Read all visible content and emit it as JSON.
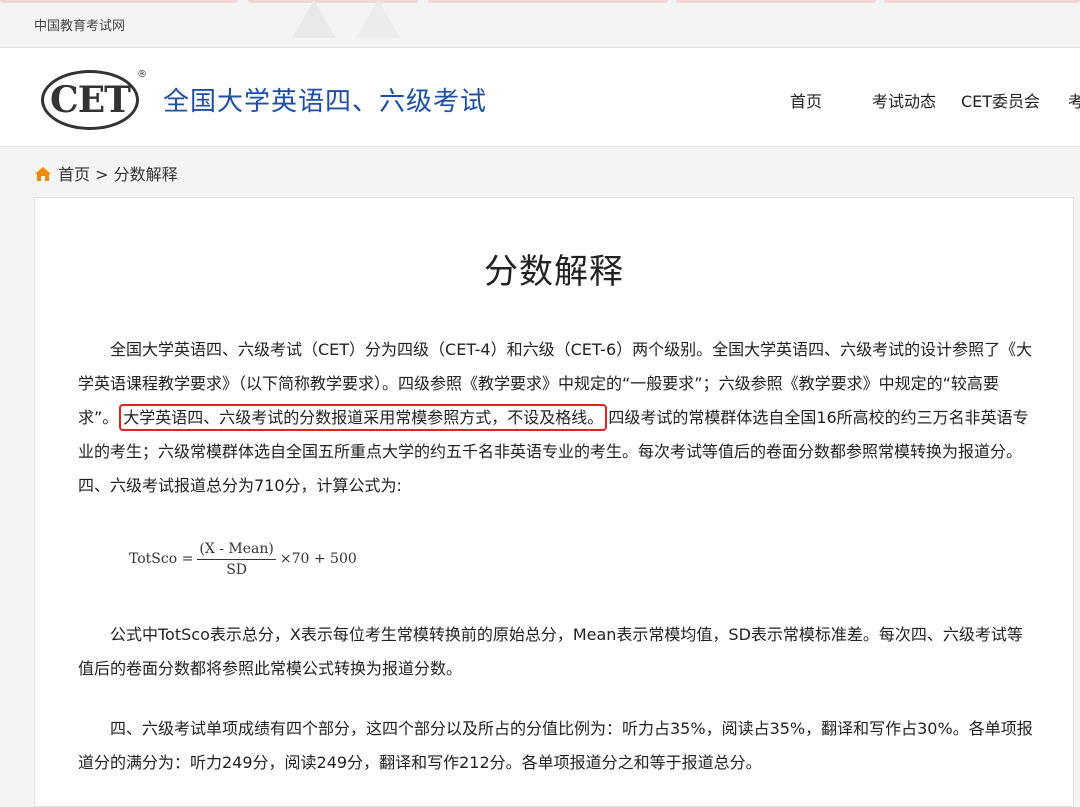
{
  "topbar": {
    "link": "中国教育考试网"
  },
  "header": {
    "logo_text": "CET",
    "logo_reg": "®",
    "site_title": "全国大学英语四、六级考试",
    "nav": [
      "首页",
      "考试动态",
      "CET委员会",
      "考"
    ]
  },
  "breadcrumb": {
    "home": "首页",
    "sep": " > ",
    "current": "分数解释"
  },
  "article": {
    "title": "分数解释",
    "p1_before": "全国大学英语四、六级考试（CET）分为四级（CET-4）和六级（CET-6）两个级别。全国大学英语四、六级考试的设计参照了《大学英语课程教学要求》（以下简称教学要求）。四级参照《教学要求》中规定的“一般要求”；六级参照《教学要求》中规定的“较高要求”。",
    "p1_highlight": "大学英语四、六级考试的分数报道采用常模参照方式，不设及格线。",
    "p1_after": "四级考试的常模群体选自全国16所高校的约三万名非英语专业的考生；六级常模群体选自全国五所重点大学的约五千名非英语专业的考生。每次考试等值后的卷面分数都参照常模转换为报道分。四、六级考试报道总分为710分，计算公式为:",
    "formula": {
      "lhs": "TotSco =",
      "numerator": "(X - Mean)",
      "denominator": "SD",
      "rhs": "×70 + 500"
    },
    "p2": "公式中TotSco表示总分，X表示每位考生常模转换前的原始总分，Mean表示常模均值，SD表示常模标准差。每次四、六级考试等值后的卷面分数都将参照此常模公式转换为报道分数。",
    "p3": "四、六级考试单项成绩有四个部分，这四个部分以及所占的分值比例为：听力占35%，阅读占35%，翻译和写作占30%。各单项报道分的满分为：听力249分，阅读249分，翻译和写作212分。各单项报道分之和等于报道总分。"
  },
  "colors": {
    "title_blue": "#1f4fa3",
    "highlight_red": "#e0231f",
    "home_icon": "#f08a00"
  }
}
